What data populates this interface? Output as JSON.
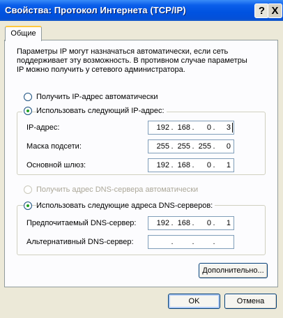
{
  "window": {
    "title": "Свойства: Протокол Интернета (TCP/IP)",
    "help_glyph": "?",
    "close_glyph": "X"
  },
  "tabs": [
    {
      "label": "Общие",
      "selected": true
    }
  ],
  "intro_lines": [
    "Параметры IP могут назначаться автоматически, если сеть",
    "поддерживает эту возможность. В противном случае параметры",
    "IP можно получить у сетевого администратора."
  ],
  "ip_section": {
    "auto_label": "Получить IP-адрес автоматически",
    "manual_label": "Использовать следующий IP-адрес:",
    "selected": "manual",
    "fields": [
      {
        "label": "IP-адрес:",
        "octets": [
          "192",
          "168",
          "0",
          "3"
        ]
      },
      {
        "label": "Маска подсети:",
        "octets": [
          "255",
          "255",
          "255",
          "0"
        ]
      },
      {
        "label": "Основной шлюз:",
        "octets": [
          "192",
          "168",
          "0",
          "1"
        ]
      }
    ]
  },
  "dns_section": {
    "auto_label": "Получить адрес DNS-сервера автоматически",
    "manual_label": "Использовать следующие адреса DNS-серверов:",
    "selected": "manual",
    "fields": [
      {
        "label": "Предпочитаемый DNS-сервер:",
        "octets": [
          "192",
          "168",
          "0",
          "1"
        ]
      },
      {
        "label": "Альтернативный DNS-сервер:",
        "octets": [
          "",
          "",
          "",
          ""
        ]
      }
    ]
  },
  "buttons": {
    "advanced": "Дополнительно...",
    "ok": "OK",
    "cancel": "Отмена"
  },
  "colors": {
    "titlebar": "#0054E3",
    "window_bg": "#ECE9D8",
    "panel_bg": "#FCFCFE",
    "tab_accent": "#FFC83C",
    "radio_dot": "#21A121"
  }
}
